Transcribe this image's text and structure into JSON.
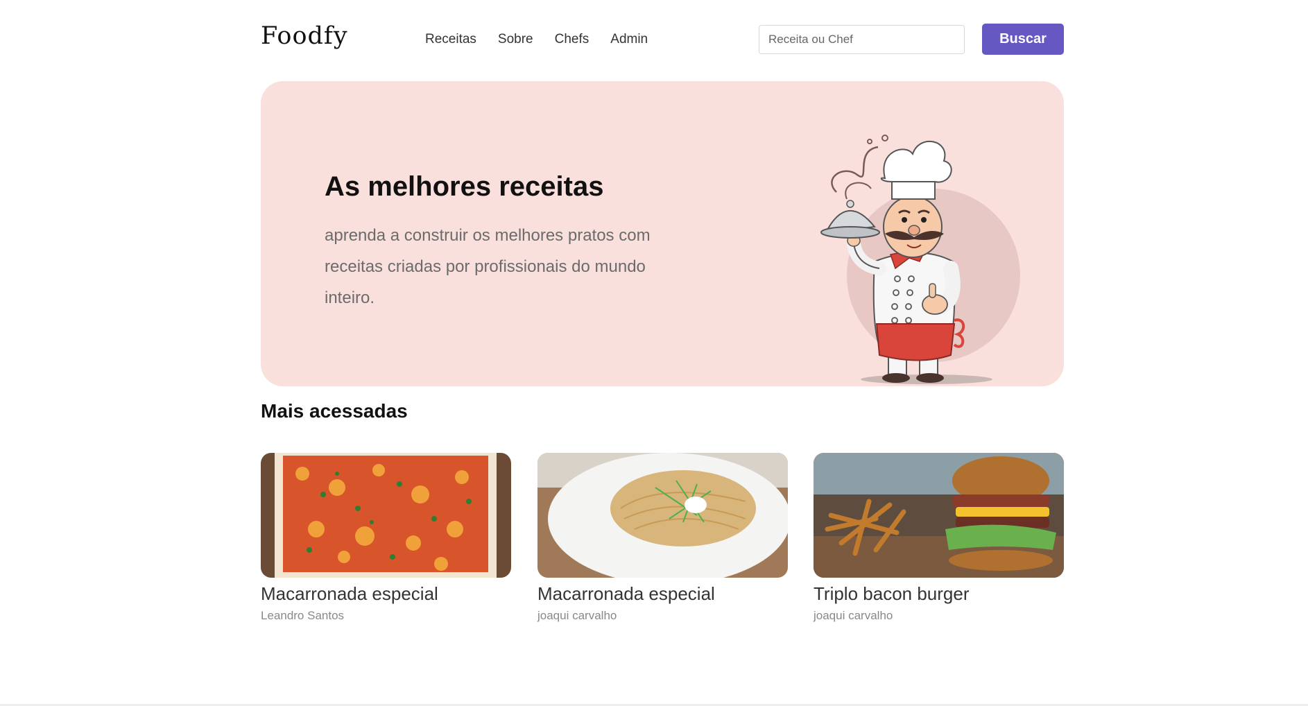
{
  "header": {
    "logo": "Foodfy",
    "nav": [
      "Receitas",
      "Sobre",
      "Chefs",
      "Admin"
    ],
    "search_placeholder": "Receita ou Chef",
    "search_value": "",
    "search_button": "Buscar"
  },
  "hero": {
    "title": "As melhores receitas",
    "subtitle": "aprenda a construir os melhores pratos com receitas criadas por profissionais do mundo inteiro."
  },
  "section_title": "Mais acessadas",
  "cards": [
    {
      "title": "Macarronada especial",
      "author": "Leandro Santos"
    },
    {
      "title": "Macarronada especial",
      "author": "joaqui carvalho"
    },
    {
      "title": "Triplo bacon burger",
      "author": "joaqui carvalho"
    }
  ],
  "colors": {
    "accent": "#6558c3",
    "hero_bg": "#fae0dc",
    "chef_apron": "#d9443b"
  }
}
